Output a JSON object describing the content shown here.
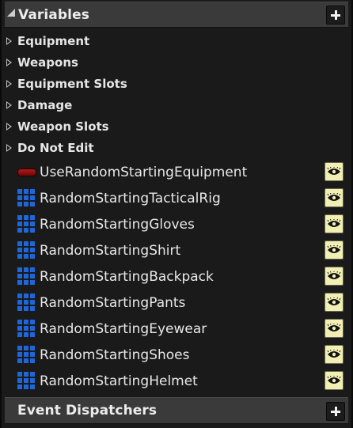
{
  "variables_section": {
    "title": "Variables",
    "add_button": "+"
  },
  "categories": [
    {
      "label": "Equipment"
    },
    {
      "label": "Weapons"
    },
    {
      "label": "Equipment Slots"
    },
    {
      "label": "Damage"
    },
    {
      "label": "Weapon Slots"
    },
    {
      "label": "Do Not Edit"
    }
  ],
  "variables": [
    {
      "name": "UseRandomStartingEquipment",
      "type_icon": "boolean-pill-icon"
    },
    {
      "name": "RandomStartingTacticalRig",
      "type_icon": "array-grid-icon"
    },
    {
      "name": "RandomStartingGloves",
      "type_icon": "array-grid-icon"
    },
    {
      "name": "RandomStartingShirt",
      "type_icon": "array-grid-icon"
    },
    {
      "name": "RandomStartingBackpack",
      "type_icon": "array-grid-icon"
    },
    {
      "name": "RandomStartingPants",
      "type_icon": "array-grid-icon"
    },
    {
      "name": "RandomStartingEyewear",
      "type_icon": "array-grid-icon"
    },
    {
      "name": "RandomStartingShoes",
      "type_icon": "array-grid-icon"
    },
    {
      "name": "RandomStartingHelmet",
      "type_icon": "array-grid-icon"
    }
  ],
  "event_dispatchers_section": {
    "title": "Event Dispatchers",
    "add_button": "+"
  },
  "colors": {
    "boolean_type": "#b21a1a",
    "array_type": "#1f66d9",
    "eye_button_bg": "#f2efb5",
    "header_bg": "#3a3a3a",
    "panel_bg": "#1a1a1a"
  }
}
